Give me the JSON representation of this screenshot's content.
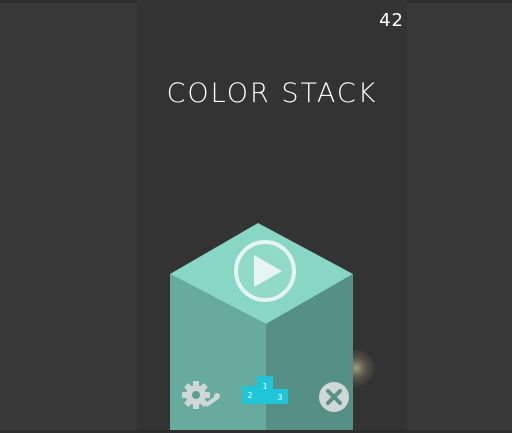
{
  "game": {
    "score": "42",
    "title": "COLOR STACK"
  },
  "podium": {
    "first": "1",
    "second": "2",
    "third": "3"
  },
  "colors": {
    "background": "#383838",
    "column": "#333333",
    "cube_top": "#88d7c6",
    "cube_left": "#66ab9e",
    "cube_right": "#568f86",
    "podium": "#1ec6d8",
    "icons": "#cfd8d6"
  },
  "icons": {
    "play": "play-icon",
    "settings": "settings-icon",
    "leaderboard": "leaderboard-icon",
    "close": "close-icon"
  }
}
